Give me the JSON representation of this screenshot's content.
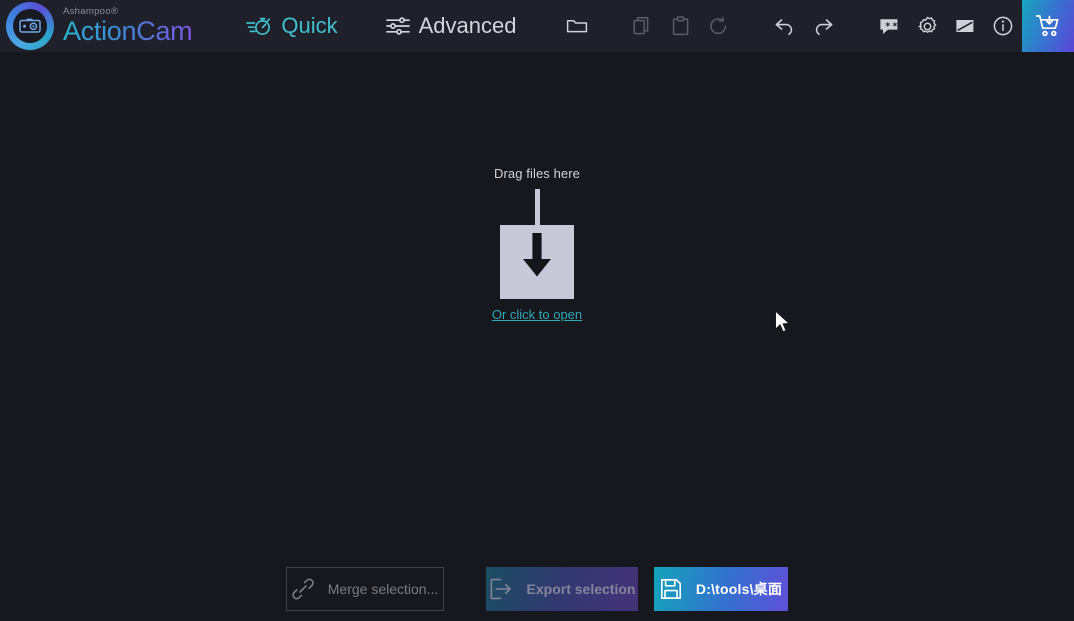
{
  "app": {
    "vendor": "Ashampoo®",
    "name": "ActionCam"
  },
  "titlebar": {
    "tabs": [
      {
        "label": "Quick",
        "icon": "stopwatch-speed-icon",
        "active": true
      },
      {
        "label": "Advanced",
        "icon": "sliders-icon",
        "active": false
      }
    ],
    "tools": [
      {
        "name": "open-folder-icon",
        "enabled": true
      },
      {
        "name": "copy-icon",
        "enabled": false
      },
      {
        "name": "paste-icon",
        "enabled": false
      },
      {
        "name": "reset-icon",
        "enabled": false
      },
      {
        "name": "undo-icon",
        "enabled": true
      },
      {
        "name": "redo-icon",
        "enabled": true
      },
      {
        "name": "feedback-icon",
        "enabled": true
      },
      {
        "name": "settings-gear-icon",
        "enabled": true
      },
      {
        "name": "image-icon",
        "enabled": true
      },
      {
        "name": "info-icon",
        "enabled": true
      }
    ],
    "buy": {
      "label": "",
      "icon": "cart-download-icon"
    },
    "window_controls": [
      {
        "name": "minimize",
        "glyph": "–"
      },
      {
        "name": "maximize",
        "glyph": "□"
      },
      {
        "name": "close",
        "glyph": "✕"
      }
    ]
  },
  "dropzone": {
    "title": "Drag files here",
    "link": "Or click to open",
    "icon": "download-into-box-icon"
  },
  "bottombar": {
    "merge": {
      "label": "Merge selection...",
      "icon": "link-chain-icon",
      "enabled": false
    },
    "export": {
      "label": "Export selection",
      "icon": "export-arrow-icon",
      "enabled": false
    },
    "save_path": {
      "label": "D:\\tools\\桌面",
      "icon": "floppy-save-icon",
      "enabled": true
    }
  },
  "colors": {
    "accent_cyan": "#3fc0cf",
    "link_cyan": "#2ea9b8",
    "gradient_start": "#14a3bb",
    "gradient_mid": "#3470ce",
    "gradient_end": "#6050d9",
    "titlebar_bg": "#20202a",
    "main_bg": "#17171e",
    "wincontrol_bg": "#2d2d3a",
    "drop_box": "#c7c9d8"
  }
}
